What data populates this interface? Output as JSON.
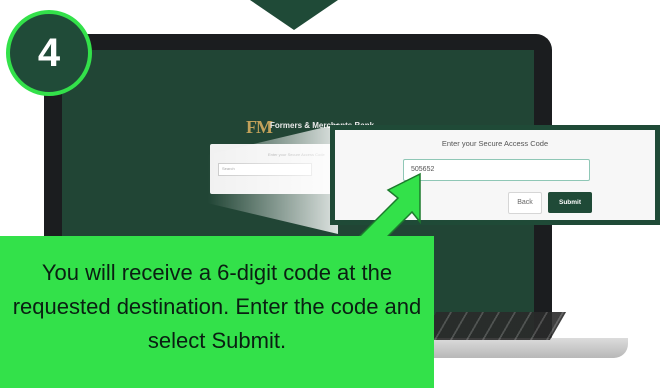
{
  "step": {
    "number": "4"
  },
  "bank": {
    "logo_mark": "FM",
    "name": "Formers & Merchants Bank"
  },
  "small_form": {
    "caption": "Enter your Secure Access Code",
    "input_text": "Search"
  },
  "zoom_form": {
    "caption": "Enter your Secure Access Code",
    "code_value": "505652",
    "back_label": "Back",
    "submit_label": "Submit"
  },
  "callout": {
    "text": "You will receive a 6-digit code at the requested destination. Enter the code and select Submit."
  },
  "colors": {
    "brand_green": "#1f4a37",
    "highlight_green": "#33e14a"
  },
  "icons": {
    "pointer": "arrow-pointer-icon",
    "down_arrow": "down-triangle-icon"
  }
}
